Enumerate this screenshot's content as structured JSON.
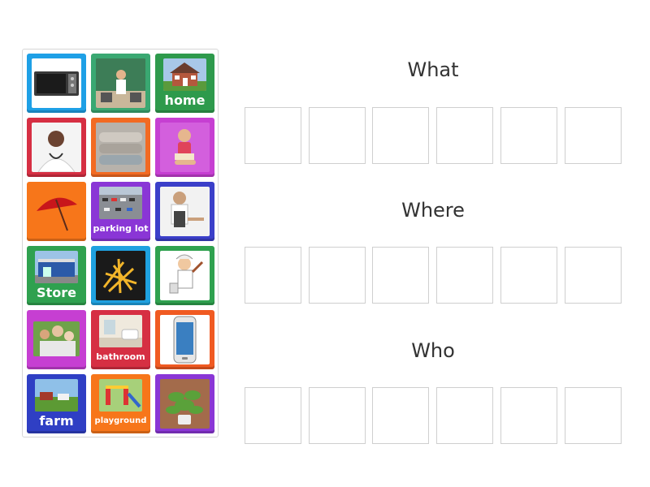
{
  "tiles": [
    {
      "name": "microwave-tile",
      "color": "#1ea0e6",
      "label": "",
      "icon": "microwave-icon"
    },
    {
      "name": "teacher-tile",
      "color": "#3aa872",
      "label": "",
      "icon": "teacher-icon"
    },
    {
      "name": "home-tile",
      "color": "#2e9a4c",
      "label": "home",
      "icon": "house-icon"
    },
    {
      "name": "doctor-tile",
      "color": "#d62f43",
      "label": "",
      "icon": "doctor-icon"
    },
    {
      "name": "towels-tile",
      "color": "#f26a22",
      "label": "",
      "icon": "towels-icon"
    },
    {
      "name": "girl-reading-tile",
      "color": "#c63fd2",
      "label": "",
      "icon": "girl-reading-icon"
    },
    {
      "name": "umbrella-tile",
      "color": "#f7761a",
      "label": "",
      "icon": "umbrella-icon"
    },
    {
      "name": "parking-lot-tile",
      "color": "#8a36d6",
      "label": "parking lot",
      "icon": "parking-lot-icon"
    },
    {
      "name": "waiter-tile",
      "color": "#3b3fc9",
      "label": "",
      "icon": "waiter-icon"
    },
    {
      "name": "store-tile",
      "color": "#2fa14f",
      "label": "Store",
      "icon": "store-icon"
    },
    {
      "name": "fries-tile",
      "color": "#1fa1e0",
      "label": "",
      "icon": "fries-icon"
    },
    {
      "name": "painter-tile",
      "color": "#2fa14f",
      "label": "",
      "icon": "painter-icon"
    },
    {
      "name": "family-tile",
      "color": "#c63fd2",
      "label": "",
      "icon": "family-icon"
    },
    {
      "name": "bathroom-tile",
      "color": "#d62f43",
      "label": "bathroom",
      "icon": "bathroom-icon"
    },
    {
      "name": "phone-tile",
      "color": "#f05a22",
      "label": "",
      "icon": "smartphone-icon"
    },
    {
      "name": "farm-tile",
      "color": "#2f3fc4",
      "label": "farm",
      "icon": "farm-icon"
    },
    {
      "name": "playground-tile",
      "color": "#f7761a",
      "label": "playground",
      "icon": "playground-icon"
    },
    {
      "name": "plant-tile",
      "color": "#8a36d6",
      "label": "",
      "icon": "plant-icon"
    }
  ],
  "groups": [
    {
      "title": "What",
      "slots": 6
    },
    {
      "title": "Where",
      "slots": 6
    },
    {
      "title": "Who",
      "slots": 6
    }
  ]
}
